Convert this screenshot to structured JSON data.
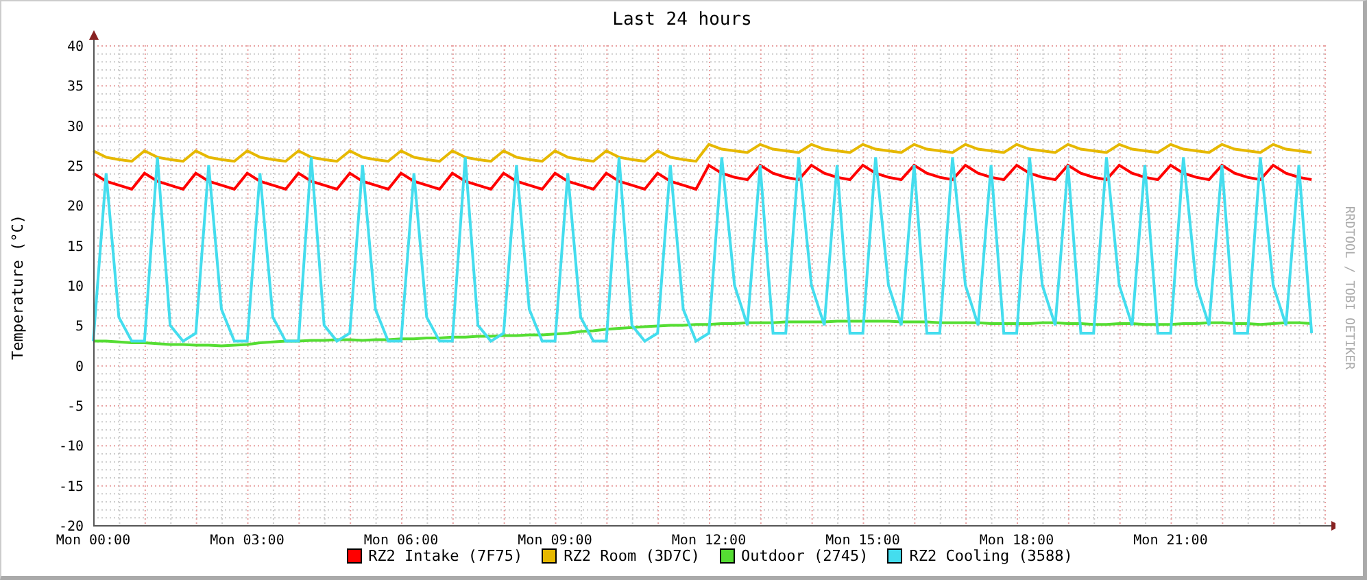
{
  "graph": {
    "credit": "RRDTOOL / TOBI OETIKER",
    "chart_data": {
      "type": "line",
      "title": "Last 24 hours",
      "grid": true,
      "ylabel": "Temperature (°C)",
      "ylim": [
        -20,
        40
      ],
      "yticks": [
        -20,
        -15,
        -10,
        -5,
        0,
        5,
        10,
        15,
        20,
        25,
        30,
        35,
        40
      ],
      "categories": [
        "Mon 00:00",
        null,
        null,
        null,
        null,
        null,
        null,
        null,
        null,
        null,
        null,
        null,
        "Mon 03:00",
        null,
        null,
        null,
        null,
        null,
        null,
        null,
        null,
        null,
        null,
        null,
        "Mon 06:00",
        null,
        null,
        null,
        null,
        null,
        null,
        null,
        null,
        null,
        null,
        null,
        "Mon 09:00",
        null,
        null,
        null,
        null,
        null,
        null,
        null,
        null,
        null,
        null,
        null,
        "Mon 12:00",
        null,
        null,
        null,
        null,
        null,
        null,
        null,
        null,
        null,
        null,
        null,
        "Mon 15:00",
        null,
        null,
        null,
        null,
        null,
        null,
        null,
        null,
        null,
        null,
        null,
        "Mon 18:00",
        null,
        null,
        null,
        null,
        null,
        null,
        null,
        null,
        null,
        null,
        null,
        "Mon 21:00",
        null,
        null,
        null,
        null,
        null,
        null,
        null,
        null,
        null,
        null,
        null
      ],
      "series": [
        {
          "name": "RZ2 Intake (7F75)",
          "color": "#ff0000",
          "values": [
            24,
            23,
            22.5,
            22,
            24,
            23,
            22.5,
            22,
            24,
            23,
            22.5,
            22,
            24,
            23,
            22.5,
            22,
            24,
            23,
            22.5,
            22,
            24,
            23,
            22.5,
            22,
            24,
            23,
            22.5,
            22,
            24,
            23,
            22.5,
            22,
            24,
            23,
            22.5,
            22,
            24,
            23,
            22.5,
            22,
            24,
            23,
            22.5,
            22,
            24,
            23,
            22.5,
            22,
            25,
            24,
            23.5,
            23.2,
            25,
            24,
            23.5,
            23.2,
            25,
            24,
            23.5,
            23.2,
            25,
            24,
            23.5,
            23.2,
            25,
            24,
            23.5,
            23.2,
            25,
            24,
            23.5,
            23.2,
            25,
            24,
            23.5,
            23.2,
            25,
            24,
            23.5,
            23.2,
            25,
            24,
            23.5,
            23.2,
            25,
            24,
            23.5,
            23.2,
            25,
            24,
            23.5,
            23.2,
            25,
            24,
            23.5,
            23.2
          ]
        },
        {
          "name": "RZ2 Room (3D7C)",
          "color": "#e6b800",
          "values": [
            26.8,
            26,
            25.7,
            25.5,
            26.8,
            26,
            25.7,
            25.5,
            26.8,
            26,
            25.7,
            25.5,
            26.8,
            26,
            25.7,
            25.5,
            26.8,
            26,
            25.7,
            25.5,
            26.8,
            26,
            25.7,
            25.5,
            26.8,
            26,
            25.7,
            25.5,
            26.8,
            26,
            25.7,
            25.5,
            26.8,
            26,
            25.7,
            25.5,
            26.8,
            26,
            25.7,
            25.5,
            26.8,
            26,
            25.7,
            25.5,
            26.8,
            26,
            25.7,
            25.5,
            27.6,
            27,
            26.8,
            26.6,
            27.6,
            27,
            26.8,
            26.6,
            27.6,
            27,
            26.8,
            26.6,
            27.6,
            27,
            26.8,
            26.6,
            27.6,
            27,
            26.8,
            26.6,
            27.6,
            27,
            26.8,
            26.6,
            27.6,
            27,
            26.8,
            26.6,
            27.6,
            27,
            26.8,
            26.6,
            27.6,
            27,
            26.8,
            26.6,
            27.6,
            27,
            26.8,
            26.6,
            27.6,
            27,
            26.8,
            26.6,
            27.6,
            27,
            26.8,
            26.6
          ]
        },
        {
          "name": "Outdoor (2745)",
          "color": "#55dd33",
          "values": [
            3,
            3,
            2.9,
            2.8,
            2.8,
            2.7,
            2.6,
            2.6,
            2.5,
            2.5,
            2.4,
            2.5,
            2.6,
            2.8,
            2.9,
            3,
            3,
            3.1,
            3.1,
            3.2,
            3.2,
            3.1,
            3.2,
            3.2,
            3.3,
            3.3,
            3.4,
            3.4,
            3.5,
            3.5,
            3.6,
            3.6,
            3.7,
            3.7,
            3.8,
            3.8,
            3.9,
            4,
            4.2,
            4.3,
            4.5,
            4.6,
            4.7,
            4.8,
            4.9,
            5,
            5,
            5.1,
            5.1,
            5.2,
            5.2,
            5.3,
            5.3,
            5.3,
            5.4,
            5.4,
            5.4,
            5.4,
            5.5,
            5.5,
            5.5,
            5.5,
            5.5,
            5.4,
            5.4,
            5.4,
            5.3,
            5.3,
            5.3,
            5.3,
            5.2,
            5.2,
            5.2,
            5.2,
            5.3,
            5.3,
            5.2,
            5.2,
            5.1,
            5.1,
            5.2,
            5.2,
            5.1,
            5.1,
            5.1,
            5.2,
            5.2,
            5.3,
            5.3,
            5.2,
            5.2,
            5.1,
            5.2,
            5.3,
            5.3,
            5.2
          ]
        },
        {
          "name": "RZ2 Cooling (3588)",
          "color": "#44ddee",
          "values": [
            3,
            24,
            6,
            3,
            3,
            26,
            5,
            3,
            4,
            25,
            7,
            3,
            3,
            24,
            6,
            3,
            3,
            26,
            5,
            3,
            4,
            25,
            7,
            3,
            3,
            24,
            6,
            3,
            3,
            26,
            5,
            3,
            4,
            25,
            7,
            3,
            3,
            24,
            6,
            3,
            3,
            26,
            5,
            3,
            4,
            25,
            7,
            3,
            4,
            26,
            10,
            5,
            25,
            4,
            4,
            26,
            10,
            5,
            25,
            4,
            4,
            26,
            10,
            5,
            25,
            4,
            4,
            26,
            10,
            5,
            25,
            4,
            4,
            26,
            10,
            5,
            25,
            4,
            4,
            26,
            10,
            5,
            25,
            4,
            4,
            26,
            10,
            5,
            25,
            4,
            4,
            26,
            10,
            5,
            25,
            4
          ]
        }
      ]
    }
  }
}
